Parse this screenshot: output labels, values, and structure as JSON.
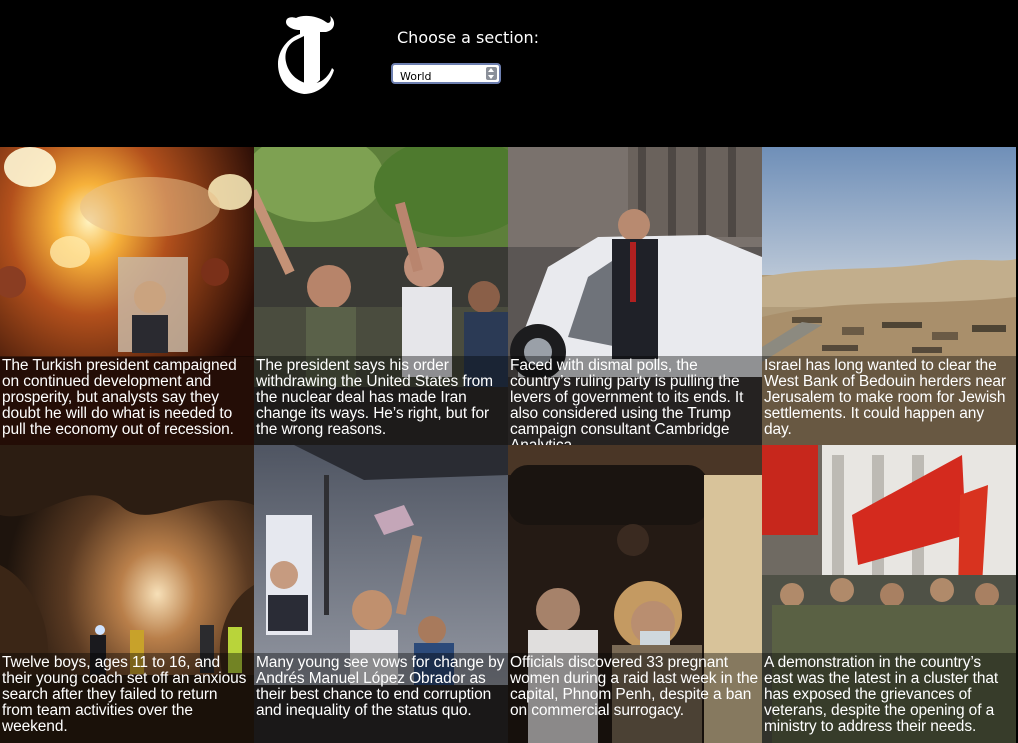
{
  "header": {
    "logo_icon": "nyt-t-logo-icon",
    "choose_label": "Choose a section:",
    "section_select": {
      "selected": "World",
      "options": [
        "World"
      ]
    }
  },
  "articles": [
    {
      "abstract": "The Turkish president campaigned on continued development and prosperity, but analysts say they doubt he will do what is needed to pull the economy out of recession.",
      "image": "flares-rally-photo"
    },
    {
      "abstract": "The president says his order withdrawing the United States from the nuclear deal has made Iran change its ways. He’s right, but for the wrong reasons.",
      "image": "crowd-protest-photo"
    },
    {
      "abstract": "Faced with dismal polls, the country’s ruling party is pulling the levers of government to its ends. It also considered using the Trump campaign consultant Cambridge Analytica.",
      "image": "politician-car-photo"
    },
    {
      "abstract": "Israel has long wanted to clear the West Bank of Bedouin herders near Jerusalem to make room for Jewish settlements. It could happen any day.",
      "image": "desert-settlement-photo"
    },
    {
      "abstract": "Twelve boys, ages 11 to 16, and their young coach set off an anxious search after they failed to return from team activities over the weekend.",
      "image": "cave-search-photo"
    },
    {
      "abstract": "Many young see vows for change by Andrés Manuel López Obrador as their best chance to end corruption and inequality of the status quo.",
      "image": "campaign-rally-photo"
    },
    {
      "abstract": "Officials discovered 33 pregnant women during a raid last week in the capital, Phnom Penh, despite a ban on commercial surrogacy.",
      "image": "raid-women-photo"
    },
    {
      "abstract": "A demonstration in the country’s east was the latest in a cluster that has exposed the grievances of veterans, despite the opening of a ministry to address their needs.",
      "image": "red-flags-demonstration-photo"
    }
  ]
}
